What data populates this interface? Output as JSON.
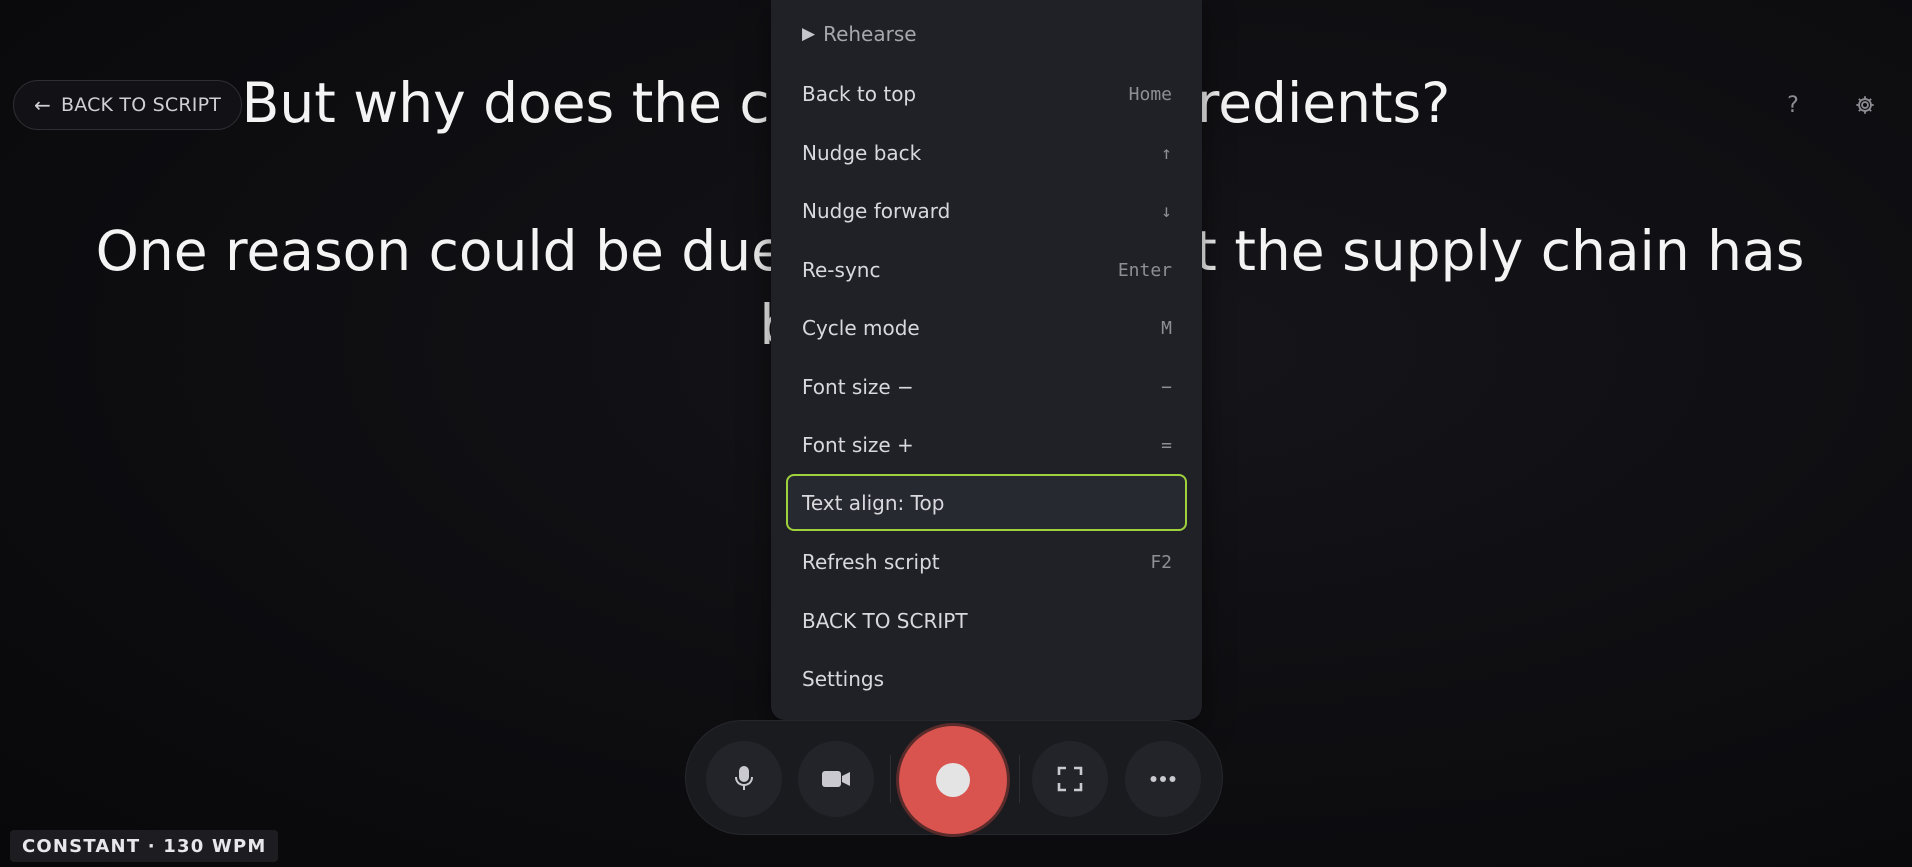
{
  "top_bar": {
    "back_label": "BACK TO SCRIPT",
    "back_arrow": "←",
    "help_glyph": "?",
    "settings_icon": "gear-icon"
  },
  "script": {
    "line1": "But why does the cost of these ingredients?",
    "paragraph2": "One reason could be due to the fact that the supply chain has been affected"
  },
  "menu": {
    "header": "Rehearse",
    "items": [
      {
        "label": "Back to top",
        "shortcut": "Home"
      },
      {
        "label": "Nudge back",
        "shortcut": "↑"
      },
      {
        "label": "Nudge forward",
        "shortcut": "↓"
      },
      {
        "label": "Re-sync",
        "shortcut": "Enter"
      },
      {
        "label": "Cycle mode",
        "shortcut": "M"
      },
      {
        "label": "Font size −",
        "shortcut": "−"
      },
      {
        "label": "Font size +",
        "shortcut": "="
      },
      {
        "label": "Text align: Top",
        "shortcut": ""
      },
      {
        "label": "Refresh script",
        "shortcut": "F2"
      },
      {
        "label": "BACK TO SCRIPT",
        "shortcut": ""
      },
      {
        "label": "Settings",
        "shortcut": ""
      }
    ],
    "focused_index": 7,
    "focus_color": "#9fd13c"
  },
  "controls": {
    "buttons": [
      "microphone-icon",
      "camera-icon",
      "record-button",
      "fullscreen-icon",
      "more-icon"
    ],
    "record_color": "#d9534f"
  },
  "status": {
    "text": "CONSTANT · 130 WPM"
  }
}
